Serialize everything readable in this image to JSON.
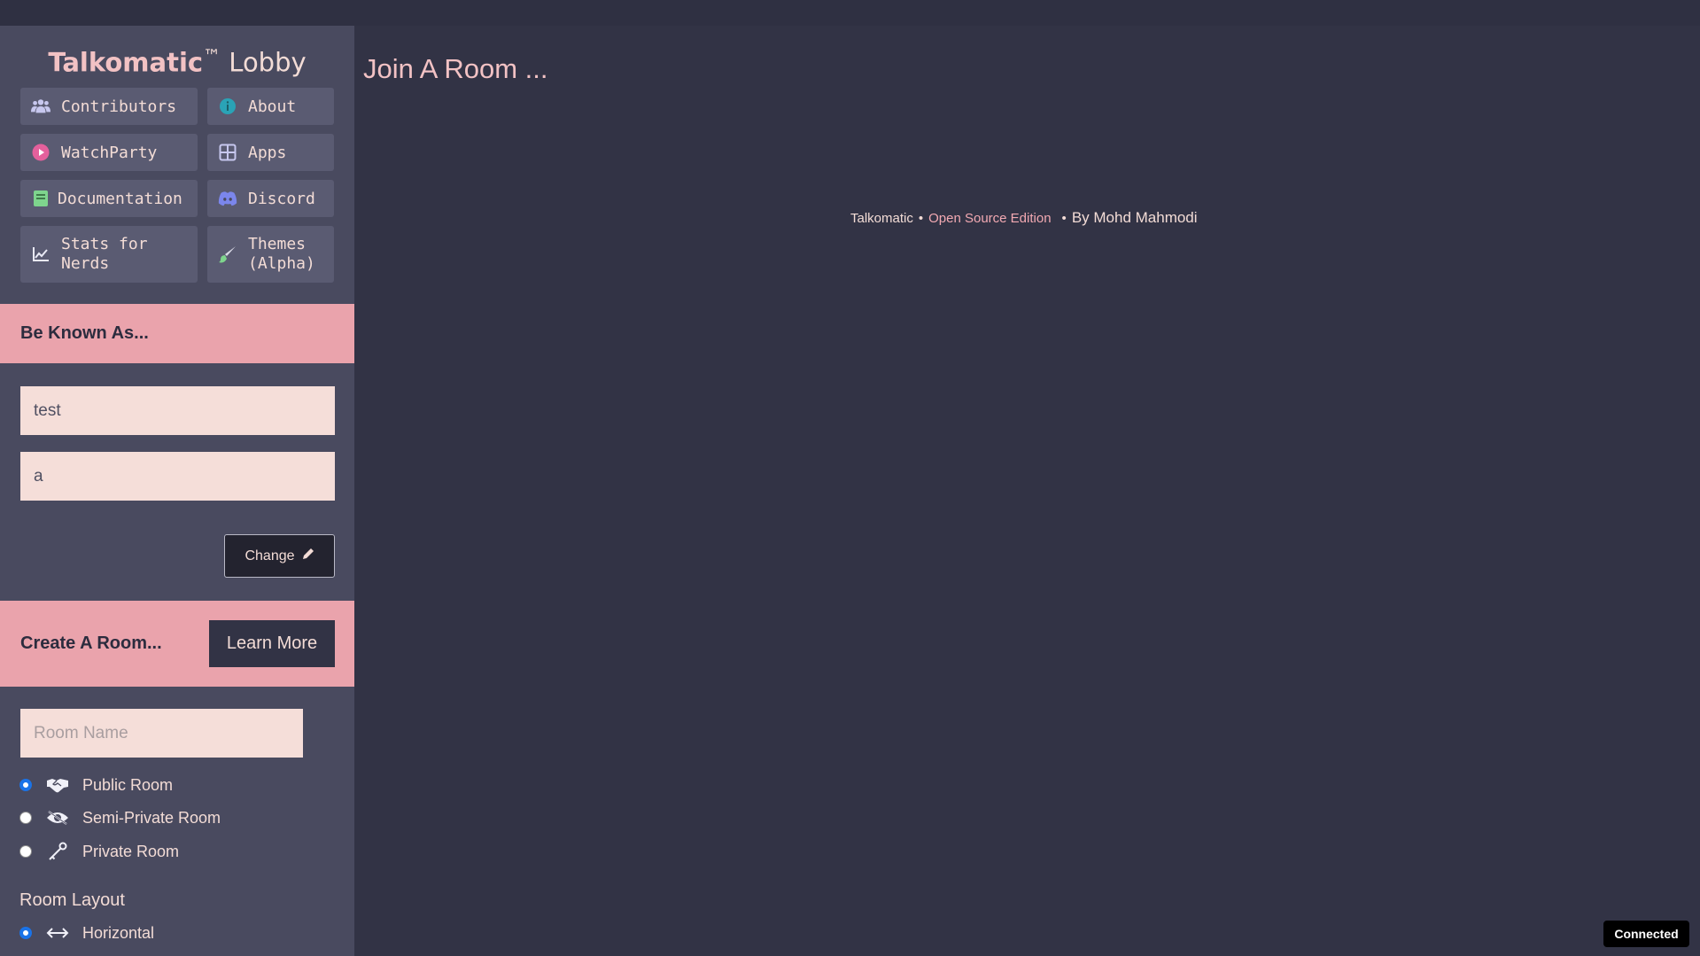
{
  "sidebar": {
    "title_brand": "Talkomatic",
    "title_tm": "™",
    "title_rest": "Lobby",
    "nav": {
      "contributors": "Contributors",
      "about": "About",
      "watchparty": "WatchParty",
      "apps": "Apps",
      "documentation": "Documentation",
      "discord": "Discord",
      "stats_line1": "Stats for",
      "stats_line2": "Nerds",
      "themes_line1": "Themes",
      "themes_line2": "(Alpha)"
    },
    "be_known": {
      "heading": "Be Known As...",
      "name_value": "test",
      "location_value": "a",
      "change_label": "Change"
    },
    "create_room": {
      "heading": "Create A Room...",
      "learn_more_label": "Learn More",
      "room_name_placeholder": "Room Name",
      "types": [
        "Public Room",
        "Semi-Private Room",
        "Private Room"
      ],
      "selected_type": "Public Room",
      "layout_heading": "Room Layout",
      "layouts": [
        "Horizontal"
      ],
      "selected_layout": "Horizontal"
    }
  },
  "main": {
    "title": "Join A Room ...",
    "footer": {
      "brand": "Talkomatic",
      "sep1": "•",
      "edition": "Open Source Edition",
      "sep2": "•",
      "author": "By Mohd Mahmodi"
    }
  },
  "status": {
    "label": "Connected"
  },
  "colors": {
    "background": "#323345",
    "sidebar": "#494a5f",
    "accent_pink": "#eaa3ac",
    "input_bg": "#f5ded9",
    "radio_selected": "#1a73e8"
  },
  "icons": {
    "contributors": "users-icon",
    "about": "info-icon",
    "watchparty": "play-icon",
    "apps": "grid-icon",
    "documentation": "book-icon",
    "discord": "discord-icon",
    "stats": "chart-line-icon",
    "themes": "brush-icon",
    "change": "pencil-icon",
    "public": "handshake-icon",
    "semi_private": "eye-slash-icon",
    "private": "key-icon",
    "horizontal": "arrows-horizontal-icon"
  }
}
